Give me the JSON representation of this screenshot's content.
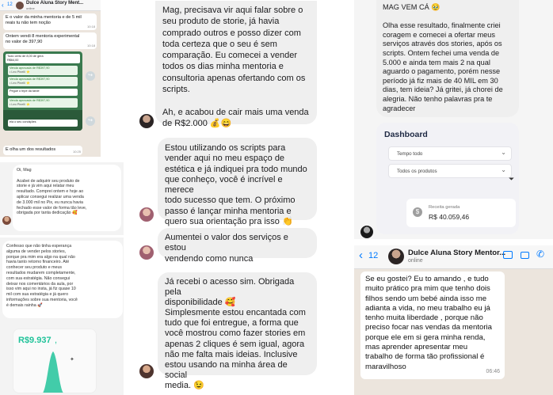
{
  "panel1": {
    "back_count": "12",
    "contact_name": "Dulce Aluna Story Ment...",
    "status": "online",
    "msg1": "E o valor da minha mentoria e de 5 mil\nreais tu não tem noção",
    "msg1_time": "10:18",
    "msg2": "Ontem vendi 8 mentoria experimental\nno valor de 397,90",
    "msg2_time": "10:18",
    "sales": [
      {
        "label": "Venda aprovada de R$397,90",
        "sub": "• Leo Pinelli ⭐"
      },
      {
        "label": "Venda aprovada de R$397,90",
        "sub": "• Leo Pinelli ⭐"
      },
      {
        "label": "Venda aprovada de R$397,90",
        "sub": "• Leo Pinelli ⭐"
      }
    ],
    "snippet1": "Tudo certo de 8,00 de gera\nR$64,00",
    "snippet2": "Pegue o tripe da tarde",
    "snippet3": "ela o seu condições",
    "msg3": "E olha um dos resultados",
    "msg3_time": "10:25"
  },
  "panel2": {
    "text": "Oi, Mag\n\nAcabei de adquirir seu produto de\nstorie e já vim aqui relatar meu\nresultado. Comprei ontem e hoje ao\naplicar consegui realizar uma venda\nde 3.000 mil no Pix, eu nunca havia\nfechado esse valor de forma tão leve,\nobrigada por tanta dedicação 🥰"
  },
  "panel3": {
    "text": "Confesso que não tinha esperança\nalguma de vender pelos stories,\nporque pra mim era algo na qual não\nhavia tanto retorno financeiro. Até\nconhecer seu produto e meus\nresultados mudarem completamente,\ncom sua estratégia. Não consegui\ndeixar nos comentários da aula, por\nisso vim aqui no insta, já fiz quase 10\nmil com sua estratégia e já quero\ninformações sobre sua mentoria, você\né demais rainha 🚀",
    "amount": "R$9.937",
    "amount_suffix": ","
  },
  "panel4": {
    "bubble1": "Mag, precisava vir aqui falar sobre o\nseu produto de storie, já havia\ncomprado outros e posso dizer com\ntoda certeza que o seu é sem\ncomparação. Eu comecei a vender\ntodos os dias minha mentoria e\nconsultoria apenas ofertando com os\nscripts.\n\nAh, e acabou de cair mais uma venda\nde R$2.000 💰😄",
    "bubble2": "Estou utilizando os scripts para\nvender aqui no meu espaço de\nestética e já indiquei pra todo mundo\nque conheço, você é incrível e merece\ntodo sucesso que tem. O próximo\npasso é lançar minha mentoria e\nquero sua orientação pra isso 👏",
    "bubble3": "Aumentei o valor dos serviços e estou\nvendendo como nunca",
    "bubble4": "Já recebi o acesso sim. Obrigada pela\ndisponibilidade 🥰\nSimplesmente estou encantada com\ntudo que foi entregue, a forma que\nvocê mostrou como fazer stories em\napenas 2 cliques é sem igual, agora\nnão me falta mais ideias. Inclusive\nestou usando na minha área de social\nmedia. 😉"
  },
  "panel6": {
    "text": "MAG VEM CÁ 🥹\n\nOlha esse resultado, finalmente criei\ncoragem e comecei a ofertar meus\nserviços através dos stories, após os\nscripts. Ontem fechei uma venda de\n5.000 e ainda tem mais 2 na qual\naguardo o pagamento, porém nesse\nperíodo já fiz mais de 40 MIL em 30\ndias, tem ideia? Já gritei, já chorei de\nalegria. Não tenho palavras pra te\nagradecer",
    "dashboard_title": "Dashboard",
    "select_period": "Tempo todo",
    "select_products": "Todos os produtos",
    "revenue_label": "Receita gerada",
    "revenue_value": "R$ 40.059,46"
  },
  "panel7": {
    "back_count": "12",
    "contact_name": "Dulce Aluna Story Mentor...",
    "status": "online",
    "message": "Se eu gostei? Eu to amando , e tudo\nmuito prático pra mim que tenho dois\nfilhos sendo um bebé ainda isso me\nadianta a vida, no meu trabalho eu já\ntenho muita liberdade , porque não\npreciso focar nas vendas da mentoria\nporque ele em si gera minha renda,\nmas aprender apresentar meu\ntrabalho de forma tão profissional é\nmaravilhoso",
    "time": "06:46"
  },
  "colors": {
    "whatsapp_blue": "#007aff",
    "chat_bg": "#ece5dd",
    "bubble_grey": "#efefef",
    "sale_green": "#2e7d32",
    "pix_teal": "#21c39a"
  }
}
